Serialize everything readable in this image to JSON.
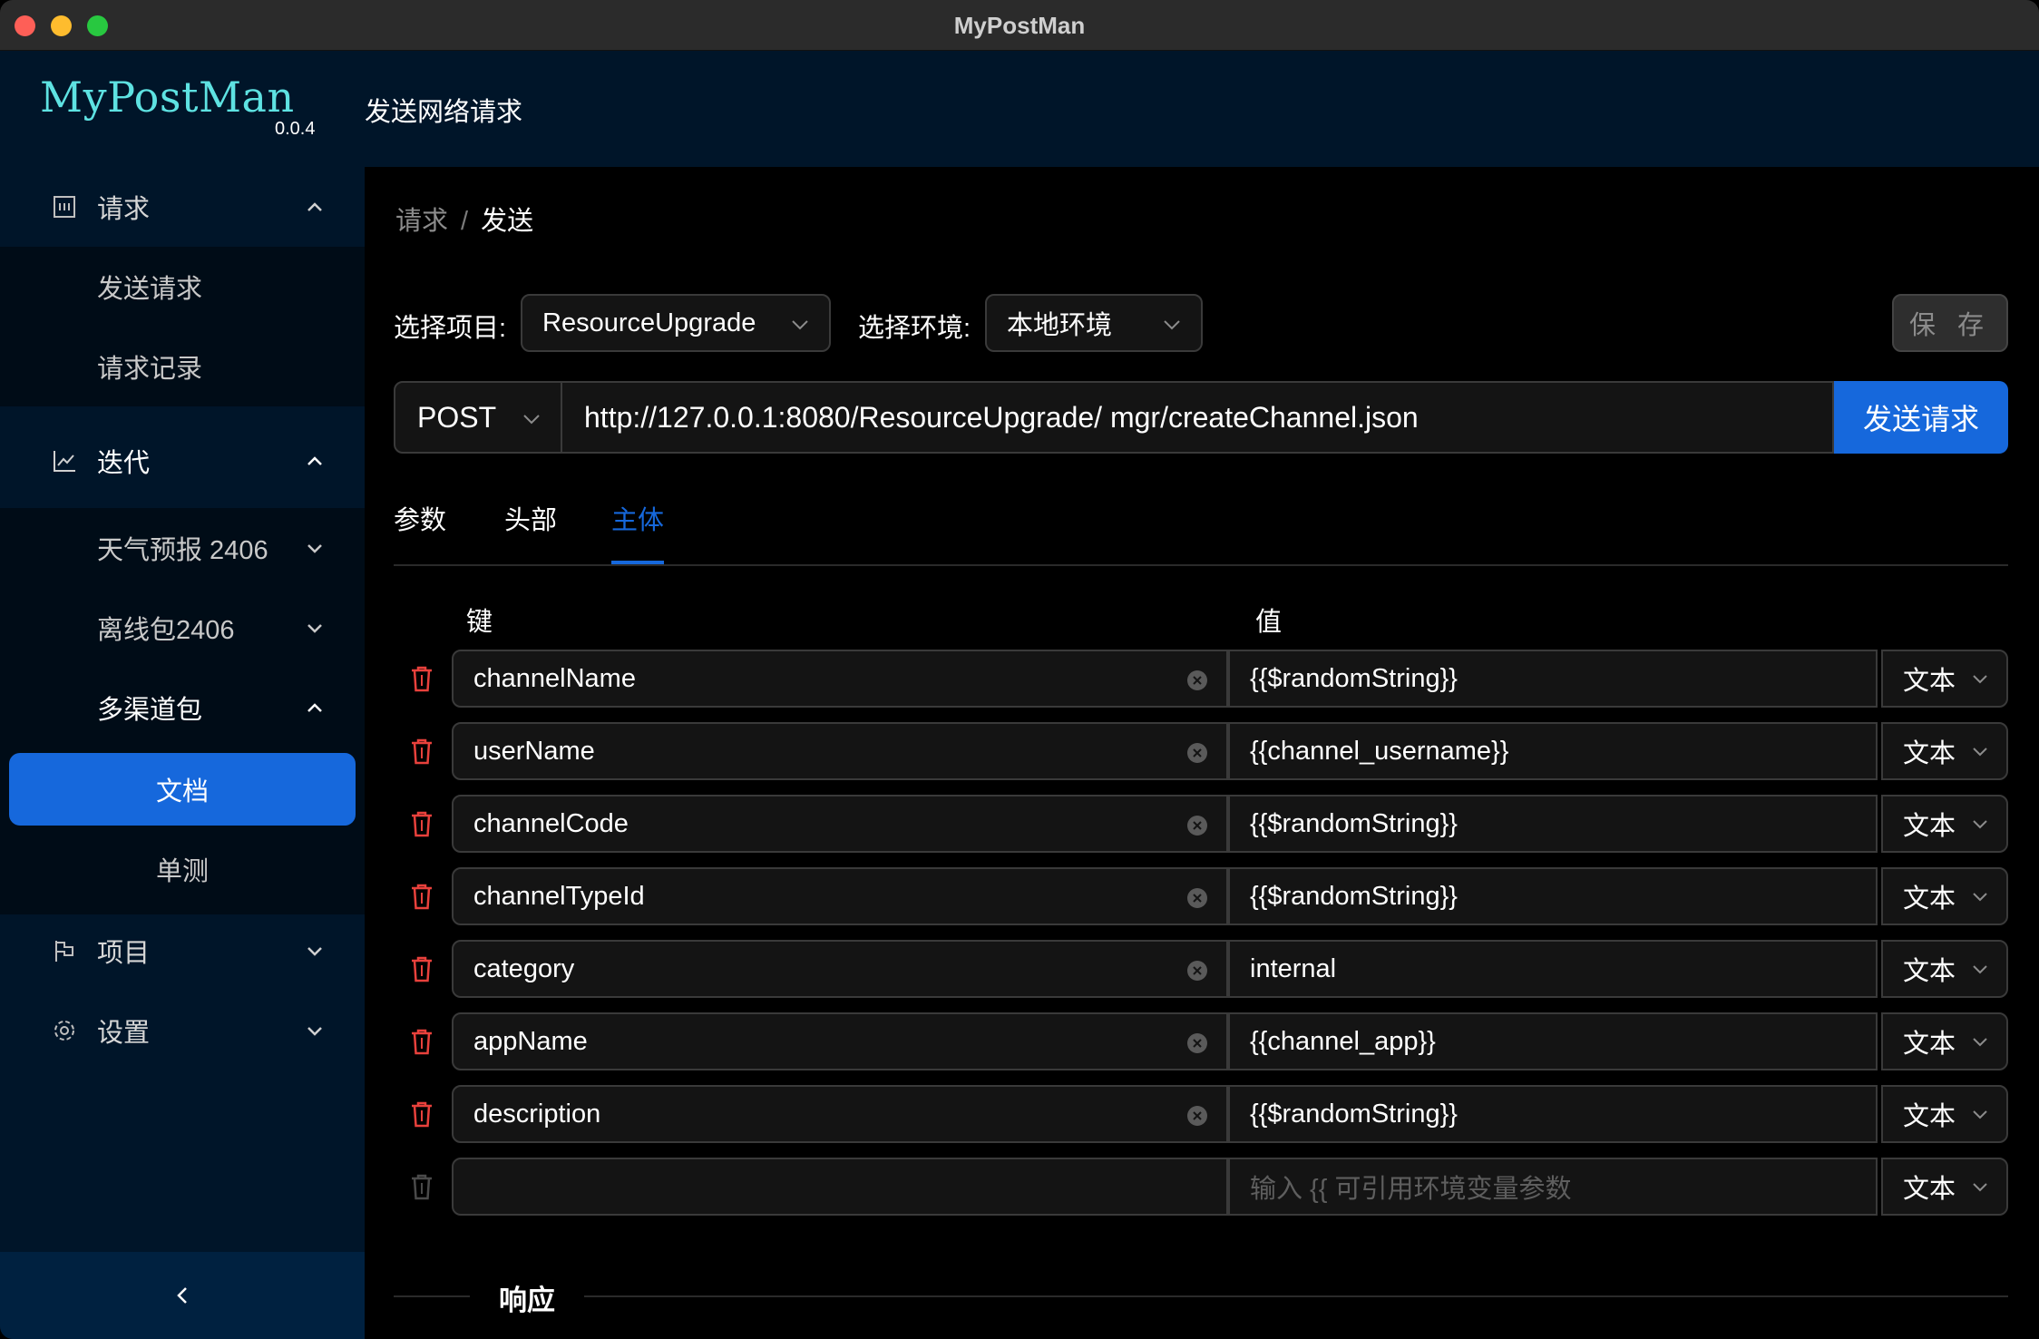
{
  "window": {
    "title": "MyPostMan"
  },
  "header": {
    "logo": "MyPostMan",
    "version": "0.0.4",
    "title": "发送网络请求"
  },
  "sidebar": {
    "requests": {
      "label": "请求",
      "items": [
        "发送请求",
        "请求记录"
      ]
    },
    "iterations": {
      "label": "迭代",
      "items": [
        {
          "label": "天气预报 2406"
        },
        {
          "label": "离线包2406"
        },
        {
          "label": "多渠道包",
          "children": [
            "文档",
            "单测"
          ]
        }
      ]
    },
    "project": {
      "label": "项目"
    },
    "settings": {
      "label": "设置"
    },
    "collapse_glyph": "<"
  },
  "breadcrumb": {
    "parent": "请求",
    "separator": "/",
    "current": "发送"
  },
  "form": {
    "project_label": "选择项目:",
    "project_value": "ResourceUpgrade",
    "env_label": "选择环境:",
    "env_value": "本地环境",
    "save_label": "保 存"
  },
  "request": {
    "method": "POST",
    "url": "http://127.0.0.1:8080/ResourceUpgrade/ mgr/createChannel.json",
    "send_label": "发送请求"
  },
  "tabs": [
    {
      "label": "参数",
      "active": false
    },
    {
      "label": "头部",
      "active": false
    },
    {
      "label": "主体",
      "active": true
    }
  ],
  "body_table": {
    "key_header": "键",
    "value_header": "值",
    "rows": [
      {
        "key": "channelName",
        "value": "{{$randomString}}",
        "type": "文本"
      },
      {
        "key": "userName",
        "value": "{{channel_username}}",
        "type": "文本"
      },
      {
        "key": "channelCode",
        "value": "{{$randomString}}",
        "type": "文本"
      },
      {
        "key": "channelTypeId",
        "value": "{{$randomString}}",
        "type": "文本"
      },
      {
        "key": "category",
        "value": "internal",
        "type": "文本"
      },
      {
        "key": "appName",
        "value": "{{channel_app}}",
        "type": "文本"
      },
      {
        "key": "description",
        "value": "{{$randomString}}",
        "type": "文本"
      }
    ],
    "new_row": {
      "key": "",
      "value_placeholder": "输入 {{ 可引用环境变量参数",
      "type": "文本"
    }
  },
  "response": {
    "label": "响应"
  },
  "colors": {
    "accent": "#1668dc",
    "sidebar": "#001529",
    "delete": "#e8413c",
    "logo": "#5ee2e2"
  }
}
